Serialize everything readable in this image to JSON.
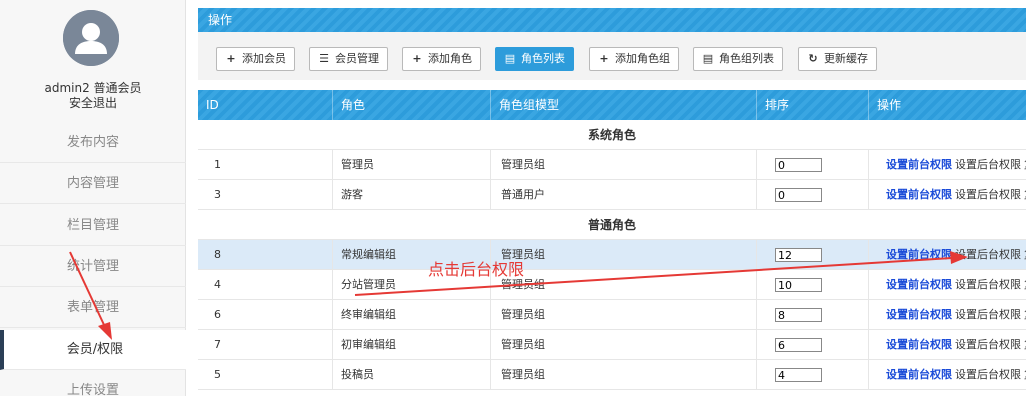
{
  "sidebar": {
    "username": "admin2 普通会员",
    "logout": "安全退出",
    "items": [
      {
        "label": "发布内容"
      },
      {
        "label": "内容管理"
      },
      {
        "label": "栏目管理"
      },
      {
        "label": "统计管理"
      },
      {
        "label": "表单管理"
      },
      {
        "label": "会员/权限",
        "active": true
      },
      {
        "label": "上传设置"
      }
    ]
  },
  "ops_header": "操作",
  "toolbar": {
    "buttons": [
      {
        "label": "添加会员",
        "icon": "plus-icon"
      },
      {
        "label": "会员管理",
        "icon": "list-icon"
      },
      {
        "label": "添加角色",
        "icon": "plus-icon"
      },
      {
        "label": "角色列表",
        "icon": "list-doc-icon",
        "active": true
      },
      {
        "label": "添加角色组",
        "icon": "plus-icon"
      },
      {
        "label": "角色组列表",
        "icon": "list-doc-icon"
      },
      {
        "label": "更新缓存",
        "icon": "refresh-icon"
      }
    ]
  },
  "table": {
    "headers": [
      "ID",
      "角色",
      "角色组模型",
      "排序",
      "操作"
    ],
    "group_system": "系统角色",
    "group_normal": "普通角色",
    "op_front": "设置前台权限",
    "op_back": "设置后台权限",
    "op_more": "复制",
    "system_rows": [
      {
        "id": "1",
        "role": "管理员",
        "model": "管理员组",
        "order": "0"
      },
      {
        "id": "3",
        "role": "游客",
        "model": "普通用户",
        "order": "0"
      }
    ],
    "normal_rows": [
      {
        "id": "8",
        "role": "常规编辑组",
        "model": "管理员组",
        "order": "12"
      },
      {
        "id": "4",
        "role": "分站管理员",
        "model": "管理员组",
        "order": "10"
      },
      {
        "id": "6",
        "role": "终审编辑组",
        "model": "管理员组",
        "order": "8"
      },
      {
        "id": "7",
        "role": "初审编辑组",
        "model": "管理员组",
        "order": "6"
      },
      {
        "id": "5",
        "role": "投稿员",
        "model": "管理员组",
        "order": "4"
      }
    ]
  },
  "annotation": {
    "text": "点击后台权限",
    "color": "#e53935"
  },
  "colors": {
    "accent": "#2d9cdb",
    "link": "#1a4bd8",
    "highlight_row": "#dbeaf8"
  }
}
